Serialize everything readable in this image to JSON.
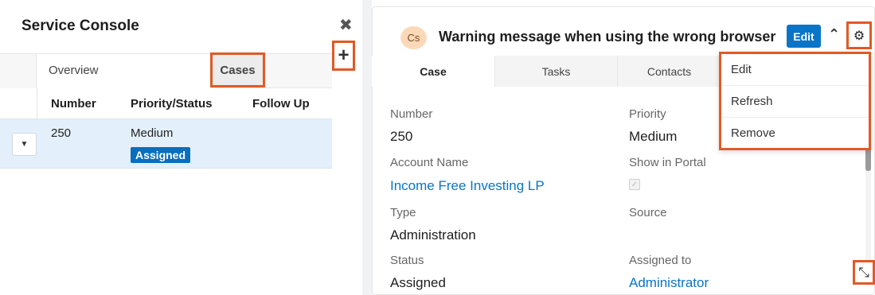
{
  "left_pane": {
    "title": "Service Console",
    "close_glyph": "✖",
    "add_glyph": "+",
    "tabs": [
      {
        "label": "Overview"
      },
      {
        "label": "Cases"
      }
    ],
    "columns": [
      "Number",
      "Priority/Status",
      "Follow Up"
    ],
    "rows": [
      {
        "number": "250",
        "priority": "Medium",
        "status": "Assigned",
        "follow_up": ""
      }
    ],
    "row_toggle_glyph": "▼"
  },
  "record": {
    "avatar_initials": "Cs",
    "title": "Warning message when using the wrong browser",
    "edit_label": "Edit",
    "chevron_glyph": "⌃",
    "gear_glyph": "⚙",
    "resize_glyph": "⤡",
    "tabs": [
      {
        "label": "Case"
      },
      {
        "label": "Tasks"
      },
      {
        "label": "Contacts"
      }
    ],
    "fields": {
      "number_label": "Number",
      "number_value": "250",
      "priority_label": "Priority",
      "priority_value": "Medium",
      "account_label": "Account Name",
      "account_value": "Income Free Investing LP",
      "portal_label": "Show in Portal",
      "type_label": "Type",
      "type_value": "Administration",
      "source_label": "Source",
      "status_label": "Status",
      "status_value": "Assigned",
      "assigned_label": "Assigned to",
      "assigned_value": "Administrator"
    }
  },
  "dropdown": {
    "items": [
      {
        "label": "Edit"
      },
      {
        "label": "Refresh"
      },
      {
        "label": "Remove"
      }
    ]
  },
  "colors": {
    "highlight": "#e05a25",
    "brand_blue": "#0a74c6",
    "row_selected": "#e3f0fb"
  }
}
